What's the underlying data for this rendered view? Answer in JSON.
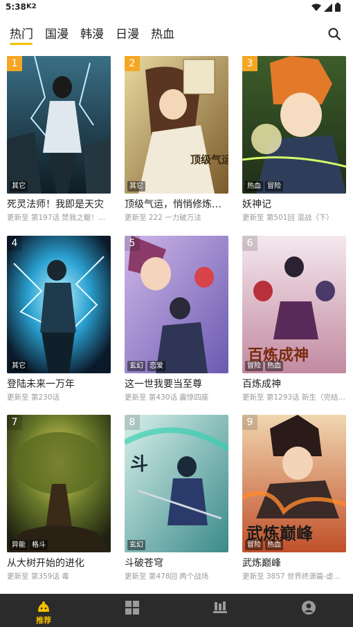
{
  "status_bar": {
    "time": "5:38",
    "carrier": "K2",
    "icons": [
      "wifi-icon",
      "signal-icon",
      "battery-icon"
    ]
  },
  "tabs": [
    {
      "label": "热门",
      "active": true
    },
    {
      "label": "国漫",
      "active": false
    },
    {
      "label": "韩漫",
      "active": false
    },
    {
      "label": "日漫",
      "active": false
    },
    {
      "label": "热血",
      "active": false
    }
  ],
  "accent_color": "#f5c000",
  "rank_top_color": "#f5a623",
  "comics": [
    {
      "rank": "1",
      "title": "死灵法师！我即是天灾",
      "update": "更新至 第197话 焚我之躯！…",
      "tags": [
        "其它"
      ]
    },
    {
      "rank": "2",
      "title": "顶级气运，悄悄修炼千年",
      "update": "更新至 222 一力破万法",
      "tags": [
        "其它"
      ]
    },
    {
      "rank": "3",
      "title": "妖神记",
      "update": "更新至 第501回 混战（下）",
      "tags": [
        "热血",
        "冒险"
      ]
    },
    {
      "rank": "4",
      "title": "登陆未来一万年",
      "update": "更新至 第230话",
      "tags": [
        "其它"
      ]
    },
    {
      "rank": "5",
      "title": "这一世我要当至尊",
      "update": "更新至 第430话 震惊四座",
      "tags": [
        "玄幻",
        "恋爱"
      ]
    },
    {
      "rank": "6",
      "title": "百炼成神",
      "update": "更新至 第1293话 新生（完结…",
      "tags": [
        "冒险",
        "热血"
      ]
    },
    {
      "rank": "7",
      "title": "从大树开始的进化",
      "update": "更新至 第359话 毒",
      "tags": [
        "异能",
        "格斗"
      ]
    },
    {
      "rank": "8",
      "title": "斗破苍穹",
      "update": "更新至 第478回 两个战场",
      "tags": [
        "玄幻"
      ]
    },
    {
      "rank": "9",
      "title": "武炼巅峰",
      "update": "更新至 3857 世界终源篇-虚…",
      "tags": [
        "冒险",
        "热血"
      ]
    }
  ],
  "bottom_nav": [
    {
      "label": "推荐",
      "icon": "recommend-icon",
      "active": true
    },
    {
      "label": "",
      "icon": "category-grid-icon",
      "active": false
    },
    {
      "label": "",
      "icon": "bookshelf-icon",
      "active": false
    },
    {
      "label": "",
      "icon": "profile-icon",
      "active": false
    }
  ]
}
